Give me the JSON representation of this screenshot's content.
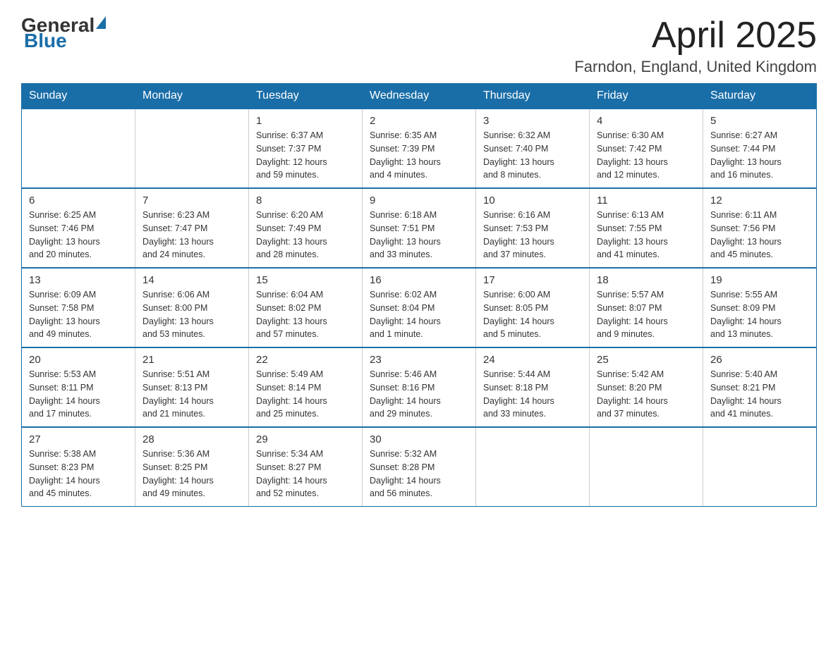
{
  "header": {
    "logo": {
      "general": "General",
      "blue": "Blue"
    },
    "title": "April 2025",
    "location": "Farndon, England, United Kingdom"
  },
  "calendar": {
    "days_of_week": [
      "Sunday",
      "Monday",
      "Tuesday",
      "Wednesday",
      "Thursday",
      "Friday",
      "Saturday"
    ],
    "weeks": [
      [
        {
          "day": "",
          "info": ""
        },
        {
          "day": "",
          "info": ""
        },
        {
          "day": "1",
          "info": "Sunrise: 6:37 AM\nSunset: 7:37 PM\nDaylight: 12 hours\nand 59 minutes."
        },
        {
          "day": "2",
          "info": "Sunrise: 6:35 AM\nSunset: 7:39 PM\nDaylight: 13 hours\nand 4 minutes."
        },
        {
          "day": "3",
          "info": "Sunrise: 6:32 AM\nSunset: 7:40 PM\nDaylight: 13 hours\nand 8 minutes."
        },
        {
          "day": "4",
          "info": "Sunrise: 6:30 AM\nSunset: 7:42 PM\nDaylight: 13 hours\nand 12 minutes."
        },
        {
          "day": "5",
          "info": "Sunrise: 6:27 AM\nSunset: 7:44 PM\nDaylight: 13 hours\nand 16 minutes."
        }
      ],
      [
        {
          "day": "6",
          "info": "Sunrise: 6:25 AM\nSunset: 7:46 PM\nDaylight: 13 hours\nand 20 minutes."
        },
        {
          "day": "7",
          "info": "Sunrise: 6:23 AM\nSunset: 7:47 PM\nDaylight: 13 hours\nand 24 minutes."
        },
        {
          "day": "8",
          "info": "Sunrise: 6:20 AM\nSunset: 7:49 PM\nDaylight: 13 hours\nand 28 minutes."
        },
        {
          "day": "9",
          "info": "Sunrise: 6:18 AM\nSunset: 7:51 PM\nDaylight: 13 hours\nand 33 minutes."
        },
        {
          "day": "10",
          "info": "Sunrise: 6:16 AM\nSunset: 7:53 PM\nDaylight: 13 hours\nand 37 minutes."
        },
        {
          "day": "11",
          "info": "Sunrise: 6:13 AM\nSunset: 7:55 PM\nDaylight: 13 hours\nand 41 minutes."
        },
        {
          "day": "12",
          "info": "Sunrise: 6:11 AM\nSunset: 7:56 PM\nDaylight: 13 hours\nand 45 minutes."
        }
      ],
      [
        {
          "day": "13",
          "info": "Sunrise: 6:09 AM\nSunset: 7:58 PM\nDaylight: 13 hours\nand 49 minutes."
        },
        {
          "day": "14",
          "info": "Sunrise: 6:06 AM\nSunset: 8:00 PM\nDaylight: 13 hours\nand 53 minutes."
        },
        {
          "day": "15",
          "info": "Sunrise: 6:04 AM\nSunset: 8:02 PM\nDaylight: 13 hours\nand 57 minutes."
        },
        {
          "day": "16",
          "info": "Sunrise: 6:02 AM\nSunset: 8:04 PM\nDaylight: 14 hours\nand 1 minute."
        },
        {
          "day": "17",
          "info": "Sunrise: 6:00 AM\nSunset: 8:05 PM\nDaylight: 14 hours\nand 5 minutes."
        },
        {
          "day": "18",
          "info": "Sunrise: 5:57 AM\nSunset: 8:07 PM\nDaylight: 14 hours\nand 9 minutes."
        },
        {
          "day": "19",
          "info": "Sunrise: 5:55 AM\nSunset: 8:09 PM\nDaylight: 14 hours\nand 13 minutes."
        }
      ],
      [
        {
          "day": "20",
          "info": "Sunrise: 5:53 AM\nSunset: 8:11 PM\nDaylight: 14 hours\nand 17 minutes."
        },
        {
          "day": "21",
          "info": "Sunrise: 5:51 AM\nSunset: 8:13 PM\nDaylight: 14 hours\nand 21 minutes."
        },
        {
          "day": "22",
          "info": "Sunrise: 5:49 AM\nSunset: 8:14 PM\nDaylight: 14 hours\nand 25 minutes."
        },
        {
          "day": "23",
          "info": "Sunrise: 5:46 AM\nSunset: 8:16 PM\nDaylight: 14 hours\nand 29 minutes."
        },
        {
          "day": "24",
          "info": "Sunrise: 5:44 AM\nSunset: 8:18 PM\nDaylight: 14 hours\nand 33 minutes."
        },
        {
          "day": "25",
          "info": "Sunrise: 5:42 AM\nSunset: 8:20 PM\nDaylight: 14 hours\nand 37 minutes."
        },
        {
          "day": "26",
          "info": "Sunrise: 5:40 AM\nSunset: 8:21 PM\nDaylight: 14 hours\nand 41 minutes."
        }
      ],
      [
        {
          "day": "27",
          "info": "Sunrise: 5:38 AM\nSunset: 8:23 PM\nDaylight: 14 hours\nand 45 minutes."
        },
        {
          "day": "28",
          "info": "Sunrise: 5:36 AM\nSunset: 8:25 PM\nDaylight: 14 hours\nand 49 minutes."
        },
        {
          "day": "29",
          "info": "Sunrise: 5:34 AM\nSunset: 8:27 PM\nDaylight: 14 hours\nand 52 minutes."
        },
        {
          "day": "30",
          "info": "Sunrise: 5:32 AM\nSunset: 8:28 PM\nDaylight: 14 hours\nand 56 minutes."
        },
        {
          "day": "",
          "info": ""
        },
        {
          "day": "",
          "info": ""
        },
        {
          "day": "",
          "info": ""
        }
      ]
    ]
  }
}
